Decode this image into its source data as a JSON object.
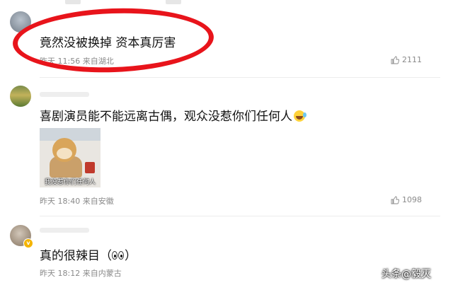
{
  "comments": [
    {
      "text": "竟然没被换掉 资本真厉害",
      "meta": "昨天 11:56 来自湖北",
      "likes": "2111"
    },
    {
      "text": "喜剧演员能不能远离古偶，观众没惹你们任何人",
      "emoji": "laugh-cry-emoji",
      "sticker_caption": "我没惹你们任何人",
      "meta": "昨天 18:40 来自安徽",
      "likes": "1098"
    },
    {
      "text_before": "真的很辣目（",
      "emoji": "eyes-emoji",
      "text_after": "）",
      "meta": "昨天 18:12 来自内蒙古"
    }
  ],
  "annotation_color": "#e8141b",
  "watermark": "头条@毅灭"
}
